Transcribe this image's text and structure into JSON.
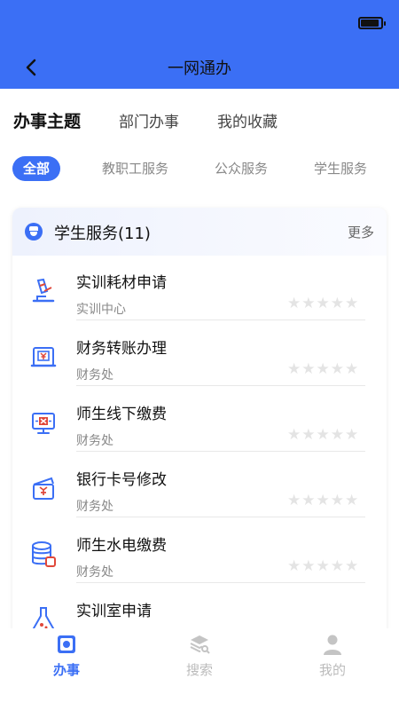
{
  "nav": {
    "title": "一网通办"
  },
  "battery": {
    "level": 0.95
  },
  "topics": [
    "办事主题",
    "部门办事",
    "我的收藏"
  ],
  "filters": [
    "全部",
    "教职工服务",
    "公众服务",
    "学生服务"
  ],
  "section": {
    "title": "学生服务(11)",
    "more": "更多",
    "items": [
      {
        "name": "实训耗材申请",
        "dept": "实训中心",
        "icon": "microscope-icon",
        "rating": 0
      },
      {
        "name": "财务转账办理",
        "dept": "财务处",
        "icon": "yen-register-icon",
        "rating": 0
      },
      {
        "name": "师生线下缴费",
        "dept": "财务处",
        "icon": "payment-monitor-icon",
        "rating": 0
      },
      {
        "name": "银行卡号修改",
        "dept": "财务处",
        "icon": "bank-card-wallet-icon",
        "rating": 0
      },
      {
        "name": "师生水电缴费",
        "dept": "财务处",
        "icon": "utility-database-icon",
        "rating": 0
      },
      {
        "name": "实训室申请",
        "dept": "",
        "icon": "flask-icon",
        "rating": 0
      }
    ],
    "star_glyphs": "★★★★★"
  },
  "tabs": [
    {
      "label": "办事",
      "icon": "affairs-icon"
    },
    {
      "label": "搜索",
      "icon": "search-layers-icon"
    },
    {
      "label": "我的",
      "icon": "user-icon"
    }
  ],
  "colors": {
    "accent": "#3b6ff5",
    "icon_red": "#e0483a",
    "star_empty": "#e4e4e4"
  }
}
